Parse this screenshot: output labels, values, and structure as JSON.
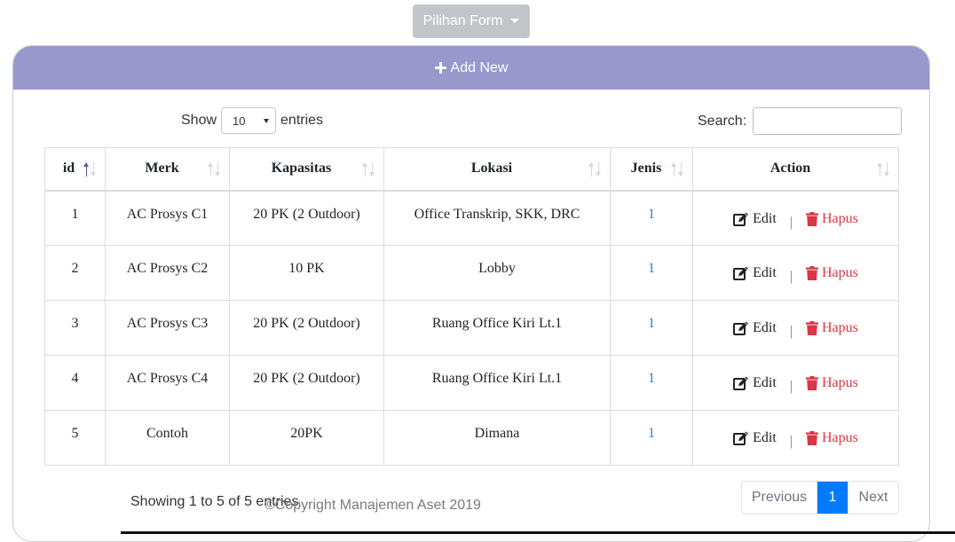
{
  "form_menu": {
    "label": "Pilihan Form"
  },
  "card": {
    "add_new_label": "Add New"
  },
  "length": {
    "show_label": "Show",
    "value": "10",
    "entries_label": "entries"
  },
  "search": {
    "label": "Search:",
    "value": ""
  },
  "table": {
    "headers": [
      "id",
      "Merk",
      "Kapasitas",
      "Lokasi",
      "Jenis",
      "Action"
    ],
    "sorted_column": "id",
    "sort_direction": "ascending",
    "rows": [
      {
        "id": "1",
        "merk": "AC Prosys C1",
        "kapasitas": "20 PK (2 Outdoor)",
        "lokasi": "Office Transkrip, SKK, DRC",
        "jenis": "1"
      },
      {
        "id": "2",
        "merk": "AC Prosys C2",
        "kapasitas": "10 PK",
        "lokasi": "Lobby",
        "jenis": "1"
      },
      {
        "id": "3",
        "merk": "AC Prosys C3",
        "kapasitas": "20 PK (2 Outdoor)",
        "lokasi": "Ruang Office Kiri Lt.1",
        "jenis": "1"
      },
      {
        "id": "4",
        "merk": "AC Prosys C4",
        "kapasitas": "20 PK (2 Outdoor)",
        "lokasi": "Ruang Office Kiri Lt.1",
        "jenis": "1"
      },
      {
        "id": "5",
        "merk": "Contoh",
        "kapasitas": "20PK",
        "lokasi": "Dimana",
        "jenis": "1"
      }
    ],
    "edit_label": "Edit",
    "separator": "|",
    "delete_label": "Hapus"
  },
  "footer": {
    "info": "Showing 1 to 5 of 5 entries",
    "copyright": "©Copyright Manajemen Aset 2019"
  },
  "pagination": {
    "previous": "Previous",
    "current": "1",
    "next": "Next"
  },
  "colors": {
    "header_bg": "#9898cc",
    "form_button_bg": "#c2c6ca",
    "link": "#2f7bd1",
    "danger": "#dc3545",
    "active_page": "#007bff"
  },
  "icons": {
    "form_menu": "caret-down-icon",
    "add_new": "plus-icon",
    "edit": "edit-icon",
    "delete": "trash-icon",
    "sort": "sort-icon"
  }
}
